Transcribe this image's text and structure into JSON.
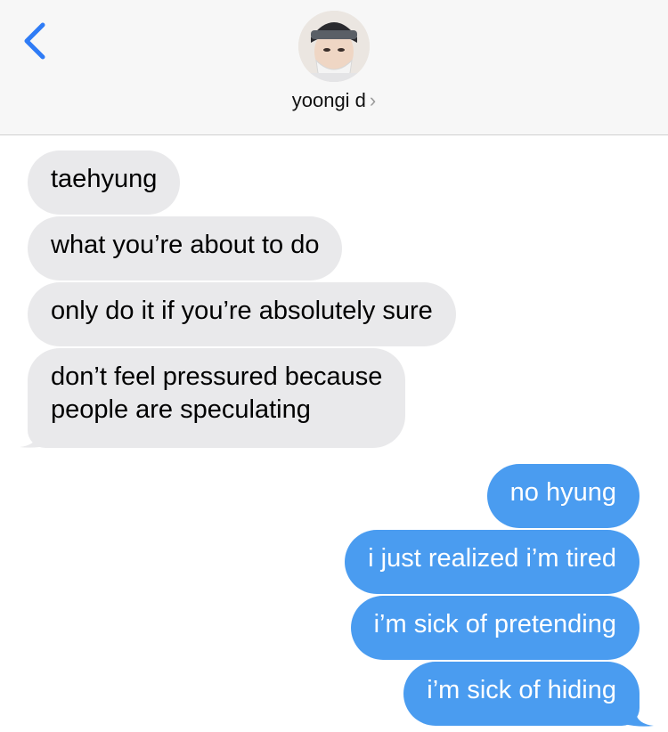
{
  "header": {
    "back_icon": "chevron-left-icon",
    "contact_name": "yoongi d",
    "contact_chevron": "›",
    "accent_color": "#2f7cf6"
  },
  "messages": [
    {
      "direction": "incoming",
      "text": "taehyung"
    },
    {
      "direction": "incoming",
      "text": "what you’re about to do"
    },
    {
      "direction": "incoming",
      "text": "only do it if you’re absolutely sure"
    },
    {
      "direction": "incoming",
      "text": "don’t feel pressured because\npeople are speculating"
    },
    {
      "direction": "outgoing",
      "text": "no hyung"
    },
    {
      "direction": "outgoing",
      "text": "i just realized i’m tired"
    },
    {
      "direction": "outgoing",
      "text": "i’m sick of pretending"
    },
    {
      "direction": "outgoing",
      "text": "i’m sick of hiding"
    }
  ],
  "colors": {
    "incoming_bubble": "#e9e9eb",
    "outgoing_bubble": "#4a9cf0",
    "header_bg": "#f7f7f7"
  }
}
